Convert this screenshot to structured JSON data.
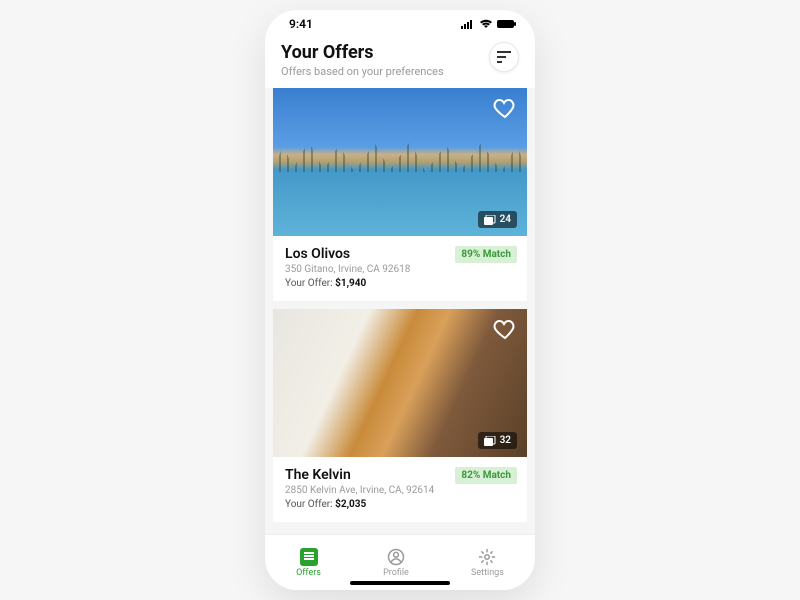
{
  "statusbar": {
    "time": "9:41"
  },
  "header": {
    "title": "Your Offers",
    "subtitle": "Offers based on your preferences"
  },
  "listings": [
    {
      "name": "Los Olivos",
      "address": "350 Gitano, Irvine, CA 92618",
      "offer_label": "Your Offer: ",
      "offer_value": "$1,940",
      "match": "89% Match",
      "photo_count": "24"
    },
    {
      "name": "The Kelvin",
      "address": "2850 Kelvin Ave, Irvine, CA, 92614",
      "offer_label": "Your Offer: ",
      "offer_value": "$2,035",
      "match": "82% Match",
      "photo_count": "32"
    }
  ],
  "tabs": {
    "offers": "Offers",
    "profile": "Profile",
    "settings": "Settings"
  }
}
